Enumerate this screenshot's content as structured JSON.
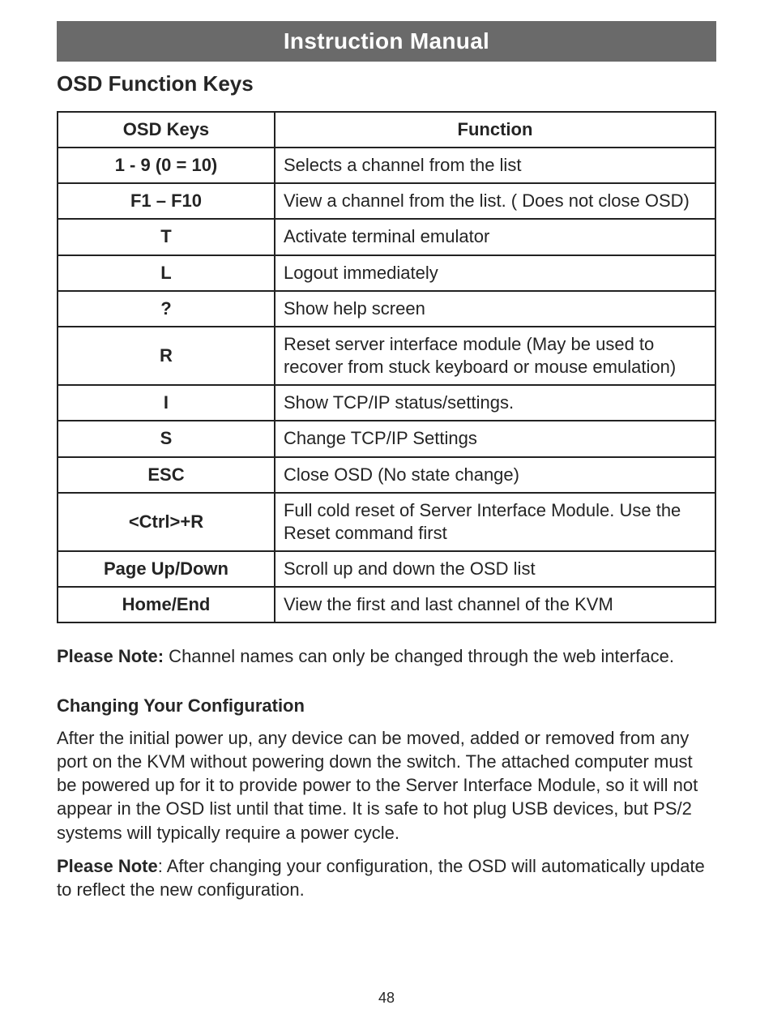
{
  "banner": {
    "title": "Instruction Manual"
  },
  "section_heading": "OSD Function Keys",
  "table": {
    "headers": {
      "col1": "OSD Keys",
      "col2": "Function"
    },
    "rows": [
      {
        "key": "1 - 9 (0 = 10)",
        "desc": "Selects a channel from the list"
      },
      {
        "key": "F1 – F10",
        "desc": "View a channel from the list. ( Does not close OSD)"
      },
      {
        "key": "T",
        "desc": "Activate terminal emulator"
      },
      {
        "key": "L",
        "desc": "Logout immediately"
      },
      {
        "key": "?",
        "desc": "Show help screen"
      },
      {
        "key": "R",
        "desc": "Reset server interface module (May be used to recover from stuck keyboard or mouse emulation)"
      },
      {
        "key": "I",
        "desc": "Show TCP/IP status/settings."
      },
      {
        "key": "S",
        "desc": "Change TCP/IP Settings"
      },
      {
        "key": "ESC",
        "desc": "Close OSD (No state change)"
      },
      {
        "key": "<Ctrl>+R",
        "desc": "Full cold reset of Server Interface Module.  Use the Reset command first"
      },
      {
        "key": "Page Up/Down",
        "desc": "Scroll up and down the OSD list"
      },
      {
        "key": "Home/End",
        "desc": "View the first and last channel of the KVM"
      }
    ]
  },
  "note1": {
    "bold": "Please Note:",
    "rest": "  Channel names can only be changed through the web interface."
  },
  "subheading": "Changing Your Configuration",
  "para1": "After the initial power up, any device can be moved, added or removed from any port on the KVM without powering down the switch.  The attached computer must be powered up for it to provide power to the Server Interface Module, so it will not appear in the OSD list until that time.  It is safe to hot plug USB devices, but PS/2 systems will typically require a power cycle.",
  "note2": {
    "bold": "Please Note",
    "rest": ": After changing your configuration, the OSD will automatically update to reflect the new configuration."
  },
  "page_number": "48"
}
